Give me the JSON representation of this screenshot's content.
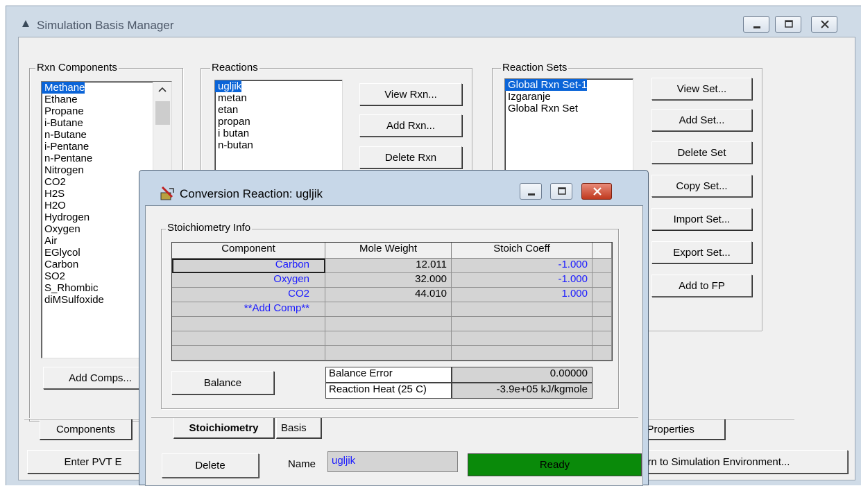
{
  "main_window": {
    "title": "Simulation Basis Manager",
    "rxn_components": {
      "label": "Rxn Components",
      "items": [
        "Methane",
        "Ethane",
        "Propane",
        "i-Butane",
        "n-Butane",
        "i-Pentane",
        "n-Pentane",
        "Nitrogen",
        "CO2",
        "H2S",
        "H2O",
        "Hydrogen",
        "Oxygen",
        "Air",
        "EGlycol",
        "Carbon",
        "SO2",
        "S_Rhombic",
        "diMSulfoxide"
      ],
      "selected": "Methane",
      "add_button": "Add Comps..."
    },
    "reactions": {
      "label": "Reactions",
      "items": [
        "ugljik",
        "metan",
        "etan",
        "propan",
        "i butan",
        "n-butan"
      ],
      "selected": "ugljik",
      "view_button": "View Rxn...",
      "add_button": "Add Rxn...",
      "delete_button": "Delete Rxn"
    },
    "reaction_sets": {
      "label": "Reaction Sets",
      "items": [
        "Global Rxn Set-1",
        "Izgaranje",
        "Global Rxn Set"
      ],
      "selected": "Global Rxn Set-1",
      "buttons": [
        "View Set...",
        "Add Set...",
        "Delete Set",
        "Copy Set...",
        "Import Set...",
        "Export Set...",
        "Add to FP"
      ]
    },
    "tabs": [
      "Components",
      "er Properties"
    ],
    "bottom_buttons": [
      "Enter PVT E",
      "urn to Simulation Environment..."
    ]
  },
  "dialog": {
    "title": "Conversion Reaction: ugljik",
    "group_label": "Stoichiometry Info",
    "columns": [
      "Component",
      "Mole Weight",
      "Stoich Coeff"
    ],
    "rows": [
      {
        "component": "Carbon",
        "mw": "12.011",
        "coeff": "-1.000"
      },
      {
        "component": "Oxygen",
        "mw": "32.000",
        "coeff": "-1.000"
      },
      {
        "component": "CO2",
        "mw": "44.010",
        "coeff": "1.000"
      },
      {
        "component": "**Add Comp**",
        "mw": "",
        "coeff": ""
      }
    ],
    "balance_button": "Balance",
    "balance_error_label": "Balance Error",
    "balance_error_value": "0.00000",
    "reaction_heat_label": "Reaction Heat (25 C)",
    "reaction_heat_value": "-3.9e+05 kJ/kgmole",
    "tabs": [
      "Stoichiometry",
      "Basis"
    ],
    "delete_button": "Delete",
    "name_label": "Name",
    "name_value": "ugljik",
    "status": "Ready",
    "colors": {
      "status_bg": "#0a8a0a",
      "selection": "#0a64d8",
      "blue_text": "#1a1aff"
    }
  }
}
